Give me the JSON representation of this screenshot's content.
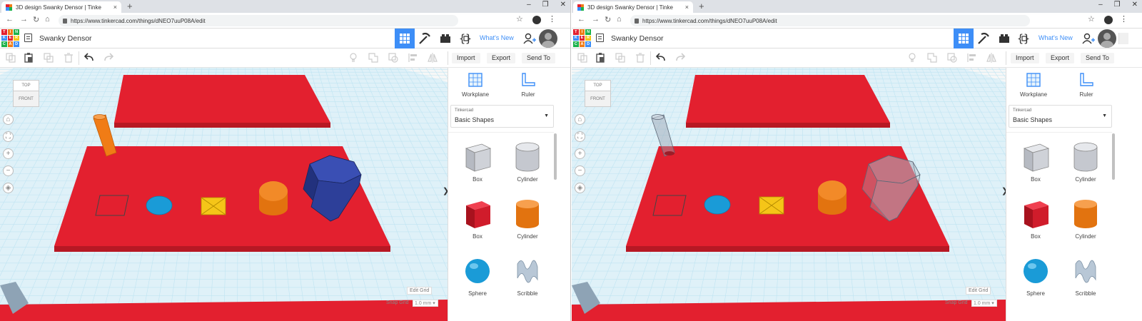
{
  "browser": {
    "tab_title": "3D design Swanky Densor | Tinke",
    "tab_close": "×",
    "new_tab": "+",
    "url": "https://www.tinkercad.com/things/dNEO7uuP08A/edit",
    "window_controls": [
      "–",
      "❐",
      "✕"
    ]
  },
  "app": {
    "logo_letters": [
      "T",
      "I",
      "N",
      "K",
      "E",
      "R",
      "C",
      "A",
      "D"
    ],
    "design_title": "Swanky Densor",
    "whats_new": "What's New",
    "toolbar_buttons": [
      "Import",
      "Export",
      "Send To"
    ]
  },
  "viewport": {
    "viewcube_top": "TOP",
    "viewcube_front": "FRONT",
    "nav_controls": [
      "⌂",
      "⛶",
      "+",
      "−",
      "◈"
    ],
    "edit_grid": "Edit Grid",
    "snap_grid_label": "Snap Grid",
    "snap_grid_value": "1.0 mm ▾",
    "collapse": "❯"
  },
  "panel": {
    "workplane_label": "Workplane",
    "ruler_label": "Ruler",
    "library_small": "Tinkercad",
    "library_name": "Basic Shapes",
    "library_caret": "▼",
    "shapes": [
      "Box",
      "Cylinder",
      "Box",
      "Cylinder",
      "Sphere",
      "Scribble"
    ]
  },
  "colors": {
    "brand_blue": "#3d8ef7",
    "plate_red": "#e3202f",
    "hexprism_blue": "#2d3f99",
    "cylinder_orange": "#f07c16",
    "sphere_blue": "#1a9bd7",
    "roof_yellow": "#f5c518",
    "workplane_grid": "#bfe4f2"
  },
  "scene_left": {
    "hexagonal_prism_style": "solid",
    "post_style": "solid"
  },
  "scene_right": {
    "hexagonal_prism_style": "hole",
    "post_style": "hole"
  }
}
